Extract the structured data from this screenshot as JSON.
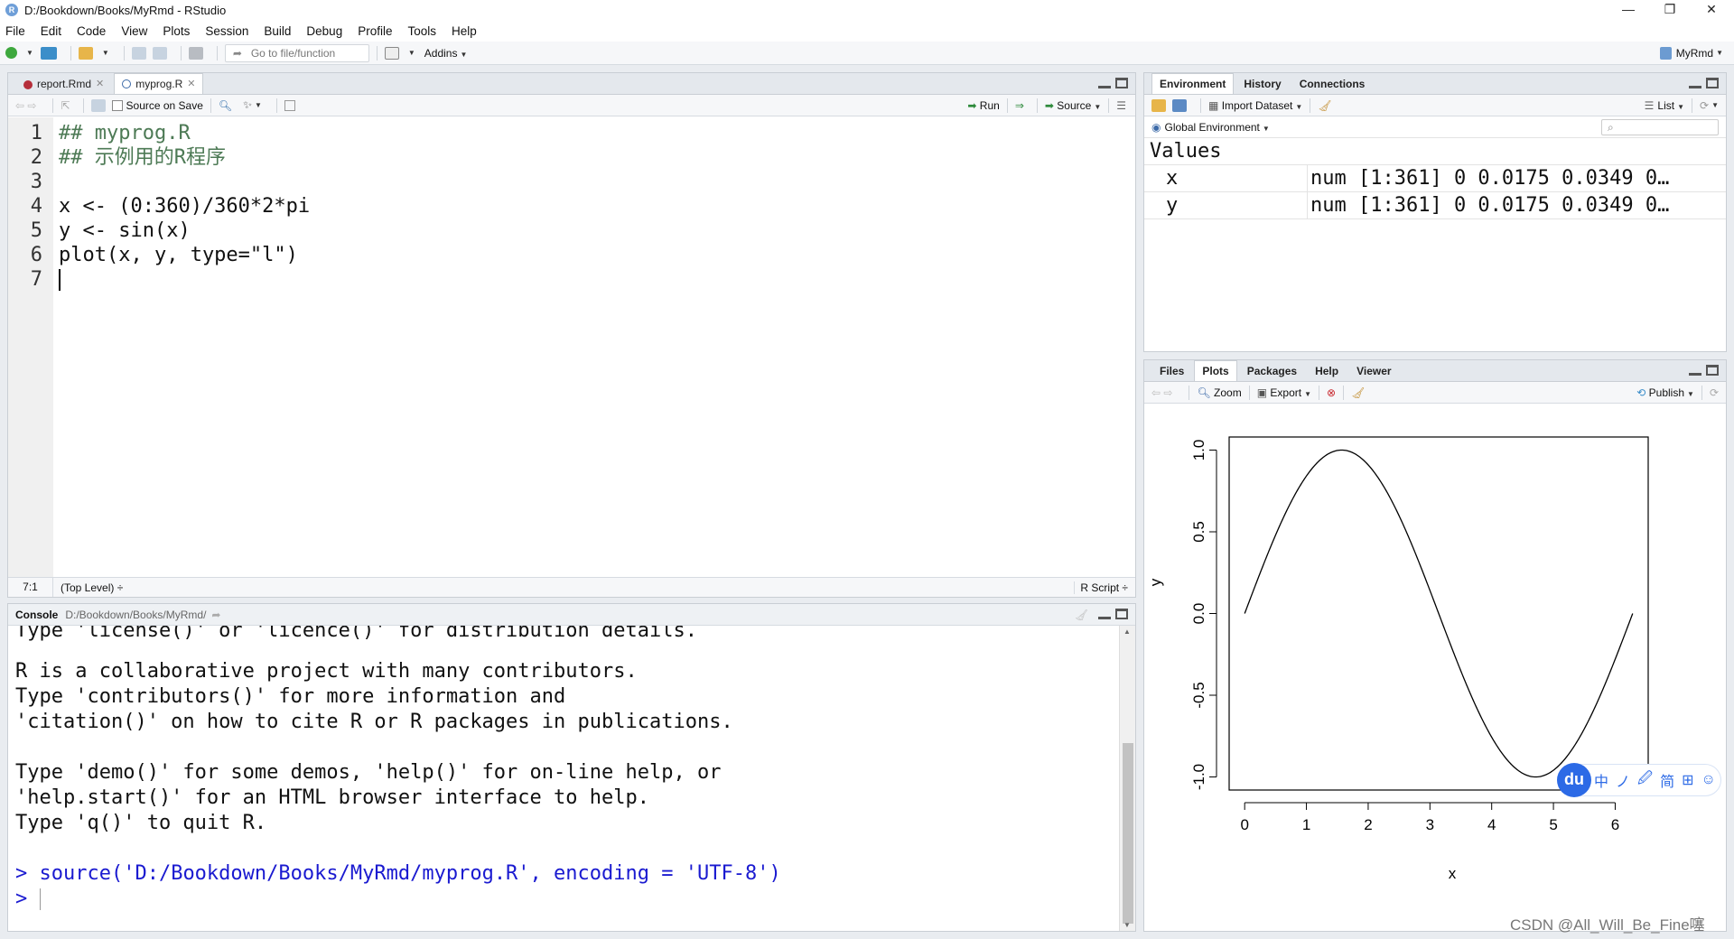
{
  "window": {
    "title": "D:/Bookdown/Books/MyRmd - RStudio",
    "app_icon": "R",
    "controls": [
      "—",
      "❐",
      "✕"
    ]
  },
  "menu": [
    "File",
    "Edit",
    "Code",
    "View",
    "Plots",
    "Session",
    "Build",
    "Debug",
    "Profile",
    "Tools",
    "Help"
  ],
  "toolbar": {
    "goto_placeholder": "Go to file/function",
    "addins": "Addins",
    "project": "MyRmd"
  },
  "editor": {
    "tabs": [
      {
        "label": "report.Rmd"
      },
      {
        "label": "myprog.R"
      }
    ],
    "source_on_save": "Source on Save",
    "run": "Run",
    "source": "Source",
    "lines": [
      {
        "n": "1",
        "text": "## myprog.R"
      },
      {
        "n": "2",
        "text": "## 示例用的R程序"
      },
      {
        "n": "3",
        "text": ""
      },
      {
        "n": "4",
        "text": "x <- (0:360)/360*2*pi"
      },
      {
        "n": "5",
        "text": "y <- sin(x)"
      },
      {
        "n": "6",
        "text": "plot(x, y, type=\"l\")"
      },
      {
        "n": "7",
        "text": ""
      }
    ],
    "status_pos": "7:1",
    "status_scope": "(Top Level) ÷",
    "status_type": "R Script ÷"
  },
  "console": {
    "tab": "Console",
    "path": "D:/Bookdown/Books/MyRmd/",
    "lines": [
      "Type 'license()' or 'licence()' for distribution details.",
      "",
      "R is a collaborative project with many contributors.",
      "Type 'contributors()' for more information and",
      "'citation()' on how to cite R or R packages in publications.",
      "",
      "Type 'demo()' for some demos, 'help()' for on-line help, or",
      "'help.start()' for an HTML browser interface to help.",
      "Type 'q()' to quit R."
    ],
    "command": "source('D:/Bookdown/Books/MyRmd/myprog.R', encoding = 'UTF-8')",
    "prompt": ">"
  },
  "environment": {
    "tabs": [
      "Environment",
      "History",
      "Connections"
    ],
    "import_dataset": "Import Dataset",
    "list_mode": "List",
    "scope": "Global Environment",
    "section": "Values",
    "values": [
      {
        "name": "x",
        "value": "num [1:361] 0 0.0175 0.0349 0…"
      },
      {
        "name": "y",
        "value": "num [1:361] 0 0.0175 0.0349 0…"
      }
    ]
  },
  "plots_pane": {
    "tabs": [
      "Files",
      "Plots",
      "Packages",
      "Help",
      "Viewer"
    ],
    "zoom": "Zoom",
    "export": "Export",
    "publish": "Publish"
  },
  "chart_data": {
    "type": "line",
    "title": "",
    "xlabel": "x",
    "ylabel": "y",
    "xlim": [
      0,
      6.2832
    ],
    "ylim": [
      -1.0,
      1.0
    ],
    "xticks": [
      "0",
      "1",
      "2",
      "3",
      "4",
      "5",
      "6"
    ],
    "yticks": [
      "-1.0",
      "-0.5",
      "0.0",
      "0.5",
      "1.0"
    ],
    "function": "y = sin(x), x from 0 to 2*pi, 361 points",
    "series": [
      {
        "x": [
          0,
          0.785,
          1.571,
          2.356,
          3.142,
          3.927,
          4.712,
          5.498,
          6.283
        ],
        "values": [
          0,
          0.707,
          1,
          0.707,
          0,
          -0.707,
          -1,
          -0.707,
          0
        ]
      }
    ]
  },
  "ime_toolbar": {
    "logo": "du",
    "items": [
      "中",
      "ノ",
      "🖉",
      "简",
      "⊞",
      "☺"
    ]
  },
  "watermark": "CSDN @All_Will_Be_Fine噻"
}
